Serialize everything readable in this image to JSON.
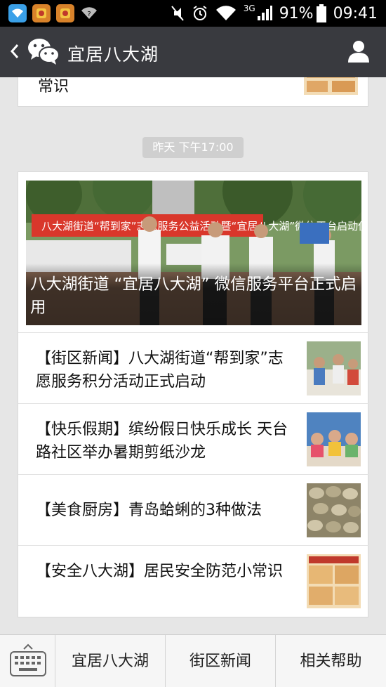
{
  "status_bar": {
    "network": "3G",
    "battery": "91%",
    "time": "09:41"
  },
  "header": {
    "title": "宜居八大湖"
  },
  "feed": {
    "top_item_text": "常识",
    "timestamp": "昨天 下午17:00",
    "hero": {
      "banner_text": "八大湖街道“帮到家”志愿服务公益活动暨“宜居八大湖”微信平台启动仪式",
      "title": "八大湖街道 “宜居八大湖” 微信服务平台正式启用"
    },
    "items": [
      {
        "title": "【街区新闻】八大湖街道“帮到家”志愿服务积分活动正式启动"
      },
      {
        "title": "【快乐假期】缤纷假日快乐成长 天台路社区举办暑期剪纸沙龙"
      },
      {
        "title": "【美食厨房】青岛蛤蜊的3种做法"
      },
      {
        "title": "【安全八大湖】居民安全防范小常识"
      }
    ]
  },
  "bottom_menu": {
    "tabs": [
      "宜居八大湖",
      "街区新闻",
      "相关帮助"
    ]
  },
  "colors": {
    "header_bg": "#393a3f",
    "page_bg": "#e6e6e6",
    "status_bg": "#000000"
  }
}
